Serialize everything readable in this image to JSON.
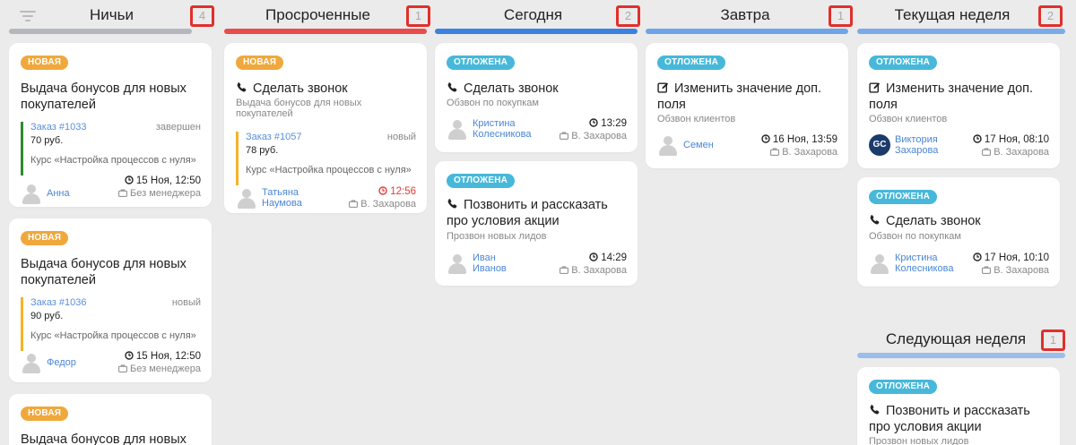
{
  "columns": [
    {
      "title": "Ничьи",
      "count": "4",
      "bar_color": "#b4b8bd"
    },
    {
      "title": "Просроченные",
      "count": "1",
      "bar_color": "#e84c4c"
    },
    {
      "title": "Сегодня",
      "count": "2",
      "bar_color": "#3b82e0"
    },
    {
      "title": "Завтра",
      "count": "1",
      "bar_color": "#6ea4e8"
    },
    {
      "title": "Текущая неделя",
      "count": "2",
      "bar_color": "#7aabe8"
    },
    {
      "title": "Следующая неделя",
      "count": "1",
      "bar_color": "#9bbdea"
    }
  ],
  "cards": {
    "c1": {
      "badge": "НОВАЯ",
      "title": "Выдача бонусов для новых покупателей",
      "order_link": "Заказ #1033",
      "order_status": "завершен",
      "order_sum": "70 руб.",
      "order_course": "Курс «Настройка процессов с нуля»",
      "person": "Анна",
      "time": "15 Ноя, 12:50",
      "manager": "Без менеджера"
    },
    "c2": {
      "badge": "НОВАЯ",
      "title": "Выдача бонусов для новых покупателей",
      "order_link": "Заказ #1036",
      "order_status": "новый",
      "order_sum": "90 руб.",
      "order_course": "Курс «Настройка процессов с нуля»",
      "person": "Федор",
      "time": "15 Ноя, 12:50",
      "manager": "Без менеджера"
    },
    "c3": {
      "badge": "НОВАЯ",
      "title": "Выдача бонусов для новых"
    },
    "c4": {
      "badge": "НОВАЯ",
      "title": "Сделать звонок",
      "subtitle": "Выдача бонусов для новых покупателей",
      "order_link": "Заказ #1057",
      "order_status": "новый",
      "order_sum": "78 руб.",
      "order_course": "Курс «Настройка процессов с нуля»",
      "person": "Татьяна Наумова",
      "time": "12:56",
      "manager": "В. Захарова"
    },
    "c5": {
      "badge": "ОТЛОЖЕНА",
      "title": "Сделать звонок",
      "subtitle": "Обзвон по покупкам",
      "person": "Кристина Колесникова",
      "time": "13:29",
      "manager": "В. Захарова"
    },
    "c6": {
      "badge": "ОТЛОЖЕНА",
      "title": "Позвонить и рассказать про условия акции",
      "subtitle": "Прозвон новых лидов",
      "person": "Иван Иванов",
      "time": "14:29",
      "manager": "В. Захарова"
    },
    "c7": {
      "badge": "ОТЛОЖЕНА",
      "title": "Изменить значение доп. поля",
      "subtitle": "Обзвон клиентов",
      "person": "Семен",
      "time": "16 Ноя, 13:59",
      "manager": "В. Захарова"
    },
    "c8": {
      "badge": "ОТЛОЖЕНА",
      "title": "Изменить значение доп. поля",
      "subtitle": "Обзвон клиентов",
      "avatar_text": "GC",
      "person": "Виктория Захарова",
      "time": "17 Ноя, 08:10",
      "manager": "В. Захарова"
    },
    "c9": {
      "badge": "ОТЛОЖЕНА",
      "title": "Сделать звонок",
      "subtitle": "Обзвон по покупкам",
      "person": "Кристина Колесникова",
      "time": "17 Ноя, 10:10",
      "manager": "В. Захарова"
    },
    "c10": {
      "badge": "ОТЛОЖЕНА",
      "title": "Позвонить и рассказать про условия акции",
      "subtitle": "Прозвон новых лидов"
    }
  }
}
